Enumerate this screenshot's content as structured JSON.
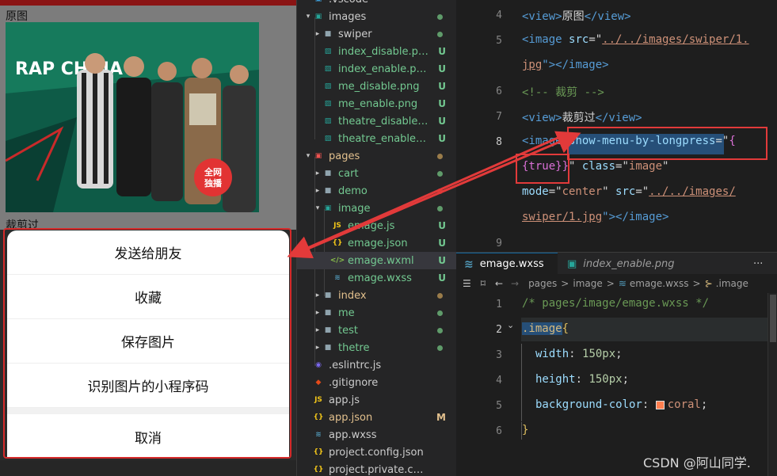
{
  "phone": {
    "label_original": "原图",
    "label_cropped": "裁剪过",
    "poster": {
      "title": "RAP CHINA",
      "badge_line1": "全网",
      "badge_line2": "独播"
    },
    "sheet": {
      "items": [
        "发送给朋友",
        "收藏",
        "保存图片",
        "识别图片的小程序码"
      ],
      "cancel": "取消"
    }
  },
  "explorer": {
    "rows": [
      {
        "name": ".vscode",
        "chev": "",
        "icon": "vscode-folder-icon",
        "status": "",
        "color": "#cccccc"
      },
      {
        "name": "images",
        "chev": "v",
        "icon": "images-folder-icon",
        "status": "dot-green",
        "color": "#cccccc"
      },
      {
        "name": "swiper",
        "chev": ">",
        "icon": "folder-icon",
        "status": "dot-green",
        "color": "#cccccc"
      },
      {
        "name": "index_disable.png",
        "chev": "",
        "icon": "image-file-icon",
        "status": "U",
        "color": "#73c991"
      },
      {
        "name": "index_enable.png",
        "chev": "",
        "icon": "image-file-icon",
        "status": "U",
        "color": "#73c991"
      },
      {
        "name": "me_disable.png",
        "chev": "",
        "icon": "image-file-icon",
        "status": "U",
        "color": "#73c991"
      },
      {
        "name": "me_enable.png",
        "chev": "",
        "icon": "image-file-icon",
        "status": "U",
        "color": "#73c991"
      },
      {
        "name": "theatre_disable....",
        "chev": "",
        "icon": "image-file-icon",
        "status": "U",
        "color": "#73c991"
      },
      {
        "name": "theatre_enable.p...",
        "chev": "",
        "icon": "image-file-icon",
        "status": "U",
        "color": "#73c991"
      },
      {
        "name": "pages",
        "chev": "v",
        "icon": "pages-folder-icon",
        "status": "dot-brown",
        "color": "#e2c08d"
      },
      {
        "name": "cart",
        "chev": ">",
        "icon": "folder-icon",
        "status": "dot-green",
        "color": "#73c991"
      },
      {
        "name": "demo",
        "chev": ">",
        "icon": "folder-icon",
        "status": "dot-red",
        "color": "#73c991"
      },
      {
        "name": "image",
        "chev": "v",
        "icon": "folder-open-icon",
        "status": "dot-green",
        "color": "#73c991"
      },
      {
        "name": "emage.js",
        "chev": "",
        "icon": "js-file-icon",
        "status": "U",
        "color": "#73c991"
      },
      {
        "name": "emage.json",
        "chev": "",
        "icon": "json-file-icon",
        "status": "U",
        "color": "#73c991"
      },
      {
        "name": "emage.wxml",
        "chev": "",
        "icon": "wxml-file-icon",
        "status": "U",
        "color": "#73c991",
        "selected": true
      },
      {
        "name": "emage.wxss",
        "chev": "",
        "icon": "wxss-file-icon",
        "status": "U",
        "color": "#73c991"
      },
      {
        "name": "index",
        "chev": ">",
        "icon": "folder-icon",
        "status": "dot-brown",
        "color": "#e2c08d"
      },
      {
        "name": "me",
        "chev": ">",
        "icon": "folder-icon",
        "status": "dot-green",
        "color": "#73c991"
      },
      {
        "name": "test",
        "chev": ">",
        "icon": "folder-icon",
        "status": "dot-green",
        "color": "#73c991"
      },
      {
        "name": "thetre",
        "chev": ">",
        "icon": "folder-icon",
        "status": "dot-green",
        "color": "#73c991"
      },
      {
        "name": ".eslintrc.js",
        "chev": "",
        "icon": "eslint-file-icon",
        "status": "",
        "color": "#cccccc"
      },
      {
        "name": ".gitignore",
        "chev": "",
        "icon": "git-file-icon",
        "status": "",
        "color": "#cccccc"
      },
      {
        "name": "app.js",
        "chev": "",
        "icon": "js-file-icon",
        "status": "",
        "color": "#cccccc"
      },
      {
        "name": "app.json",
        "chev": "",
        "icon": "json-file-icon",
        "status": "M",
        "color": "#e2c08d"
      },
      {
        "name": "app.wxss",
        "chev": "",
        "icon": "wxss-file-icon",
        "status": "",
        "color": "#cccccc"
      },
      {
        "name": "project.config.json",
        "chev": "",
        "icon": "json-file-icon",
        "status": "",
        "color": "#cccccc"
      },
      {
        "name": "project.private.config.js...",
        "chev": "",
        "icon": "json-file-icon",
        "status": "",
        "color": "#cccccc"
      }
    ]
  },
  "editor_top": {
    "line_numbers": [
      "4",
      "5",
      "",
      "6",
      "7",
      "8",
      "",
      "",
      "",
      "9"
    ],
    "lines": {
      "l1_tag_open": "<view>",
      "l1_text": "原图",
      "l1_tag_close": "</view>",
      "l2_a": "<image ",
      "l2_attr": "src",
      "l2_eq": "=\"",
      "l2_str": "../../images/swiper/1.",
      "l3_str": "jpg",
      "l3_rest": "\"></image>",
      "l4_comment": "<!-- 裁剪 -->",
      "l5_tag_open": "<view>",
      "l5_text": "裁剪过",
      "l5_tag_close": "</view>",
      "l6_tag": "<image ",
      "l6_attr": "show-menu-by-longpress",
      "l6_eq": "=\"",
      "l6_brace": "{",
      "l7_brace": "{true}}",
      "l7_q": "\" ",
      "l7_attr": "class",
      "l7_eq": "=\"",
      "l7_val": "image",
      "l7_end": "\"",
      "l8_attr": "mode",
      "l8_eq": "=\"",
      "l8_val": "center",
      "l8_mid": "\" ",
      "l8_attr2": "src",
      "l8_eq2": "=\"",
      "l8_str": "../../images/",
      "l9_str": "swiper/1.jpg",
      "l9_rest": "\"></image>"
    }
  },
  "tabs": {
    "active": "emage.wxss",
    "inactive": "index_enable.png",
    "more": "···"
  },
  "breadcrumbs": {
    "parts": [
      "pages",
      "image",
      "emage.wxss",
      ".image"
    ],
    "sep": ">"
  },
  "editor_bottom": {
    "line_numbers": [
      "1",
      "2",
      "3",
      "4",
      "5",
      "6"
    ],
    "comment": "/* pages/image/emage.wxss */",
    "selector": ".image",
    "open": "{",
    "close": "}",
    "props": [
      {
        "name": "width",
        "value": "150px"
      },
      {
        "name": "height",
        "value": "150px"
      },
      {
        "name": "background-color",
        "value": "coral",
        "swatch": "#ff7f50"
      }
    ]
  },
  "watermark": "CSDN @阿山同学."
}
